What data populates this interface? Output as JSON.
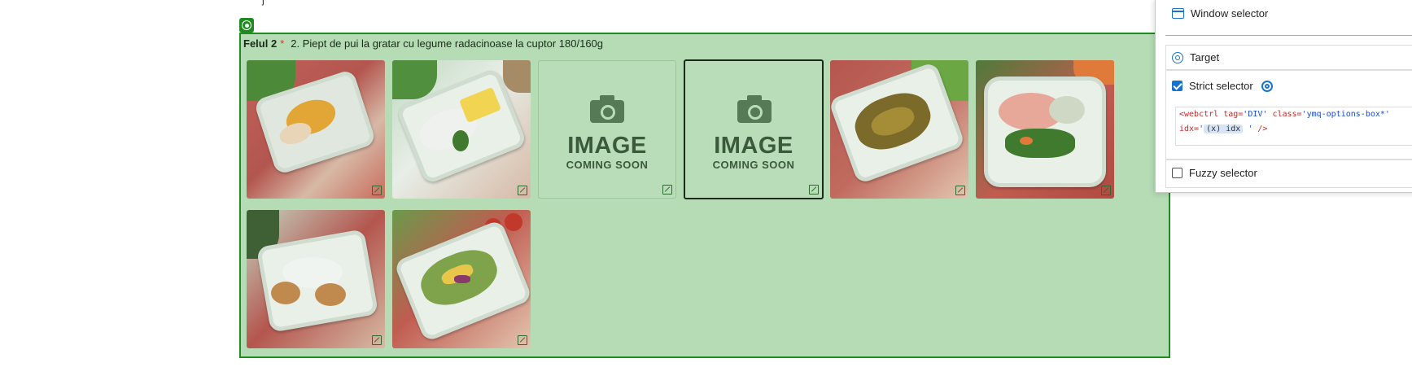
{
  "meal": {
    "label": "Felul 2",
    "required_mark": "*",
    "name": "2. Piept de pui la gratar cu legume radacinoase la cuptor 180/160g"
  },
  "placeholder": {
    "line1": "IMAGE",
    "line2": "COMING SOON"
  },
  "options": [
    {
      "kind": "photo",
      "icon": "expand-icon"
    },
    {
      "kind": "photo",
      "icon": "expand-icon"
    },
    {
      "kind": "placeholder",
      "icon": "expand-icon"
    },
    {
      "kind": "placeholder",
      "selected": true,
      "icon": "expand-icon"
    },
    {
      "kind": "photo",
      "icon": "expand-icon"
    },
    {
      "kind": "photo",
      "icon": "expand-icon"
    },
    {
      "kind": "photo",
      "icon": "expand-icon"
    },
    {
      "kind": "photo",
      "icon": "expand-icon"
    }
  ],
  "panel": {
    "window_selector": "Window selector",
    "target": "Target",
    "strict_selector": "Strict selector",
    "strict_checked": true,
    "fuzzy_selector": "Fuzzy selector",
    "fuzzy_checked": false,
    "code": {
      "open": "<webctrl",
      "attr_tag": "tag=",
      "tag_value": "'DIV'",
      "attr_class": "class=",
      "class_value": "'ymq-options-box*'",
      "attr_idx": "idx=",
      "idx_open": "'",
      "idx_variable": "(x) idx",
      "idx_close": "'",
      "close": "/>"
    }
  },
  "colors": {
    "highlight_fill": "#b5dcb5",
    "highlight_border": "#1f8a1f",
    "accent_blue": "#1a73c9"
  }
}
